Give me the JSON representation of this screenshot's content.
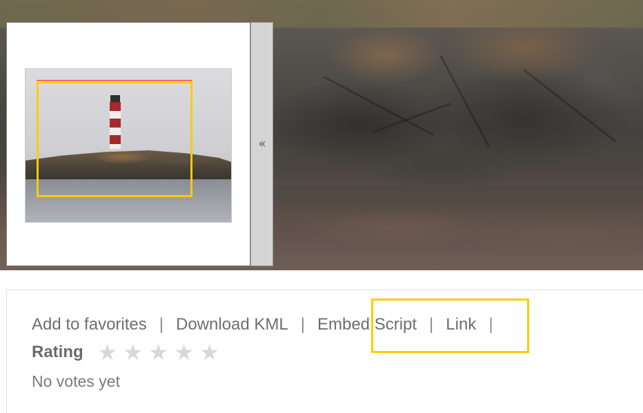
{
  "viewer": {
    "collapse_glyph": "«",
    "icon": "collapse-left-icon"
  },
  "links": {
    "add_to_favorites": "Add to favorites",
    "download_kml": "Download KML",
    "embed_script": "Embed Script",
    "link": "Link",
    "separator": "|"
  },
  "rating": {
    "label": "Rating",
    "stars": 5,
    "value": 0,
    "star_glyph": "★",
    "votes_text": "No votes yet"
  },
  "colors": {
    "highlight": "#ffcc00",
    "link_text": "#6e6e6e",
    "star_empty": "#d8d8d8"
  }
}
